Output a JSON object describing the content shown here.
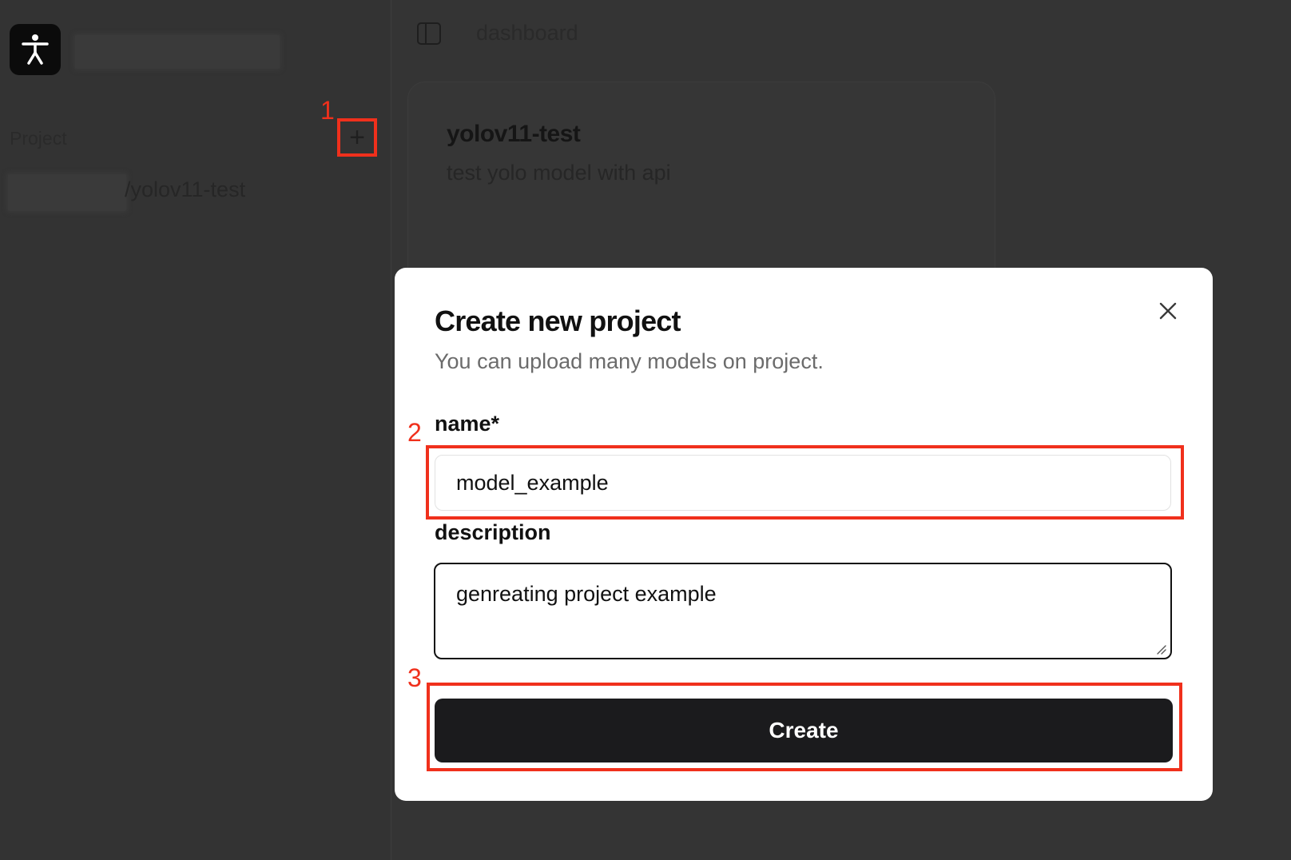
{
  "sidebar": {
    "section_label": "Project",
    "add_button_symbol": "+",
    "project_items": [
      {
        "label": "/yolov11-test"
      }
    ]
  },
  "header": {
    "breadcrumb": "dashboard",
    "toggle_icon": "sidebar-toggle-icon"
  },
  "project_card": {
    "title": "yolov11-test",
    "description": "test yolo model with api"
  },
  "modal": {
    "title": "Create new project",
    "subtitle": "You can upload many models on project.",
    "name_label": "name*",
    "name_value": "model_example",
    "description_label": "description",
    "description_value": "genreating project example",
    "create_label": "Create",
    "close_icon": "close-icon"
  },
  "annotations": {
    "step1": "1",
    "step2": "2",
    "step3": "3",
    "color": "#f0301c"
  },
  "colors": {
    "overlay_bg": "#343434",
    "modal_bg": "#ffffff",
    "primary_button": "#1b1b1d",
    "annotation_red": "#f0301c"
  }
}
